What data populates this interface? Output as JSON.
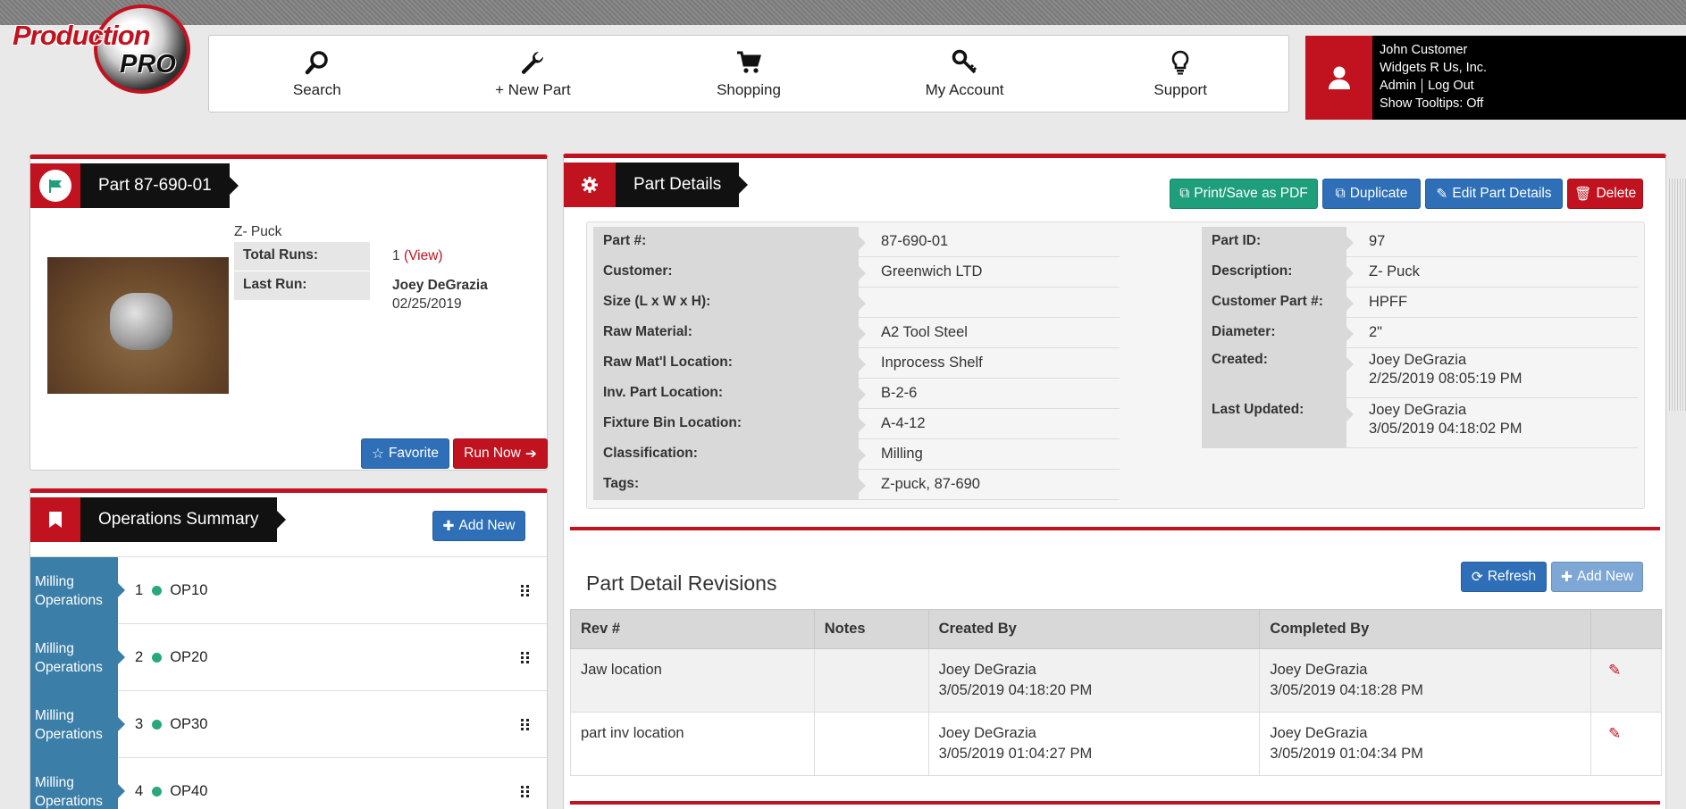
{
  "app": {
    "logo_text_1": "Production",
    "logo_text_2": "PRO"
  },
  "nav": [
    {
      "label": "Search",
      "icon": "search-icon"
    },
    {
      "label": "+ New Part",
      "icon": "wrench-icon"
    },
    {
      "label": "Shopping",
      "icon": "cart-icon"
    },
    {
      "label": "My Account",
      "icon": "key-icon"
    },
    {
      "label": "Support",
      "icon": "lightbulb-icon"
    }
  ],
  "user": {
    "name": "John Customer",
    "company": "Widgets R Us, Inc.",
    "admin_link": "Admin",
    "logout_link": "Log Out",
    "tooltips": "Show Tooltips: Off"
  },
  "part_card": {
    "title": "Part 87-690-01",
    "description": "Z- Puck",
    "total_runs_label": "Total Runs:",
    "total_runs_value": "1",
    "view_link": "(View)",
    "last_run_label": "Last Run:",
    "last_run_name": "Joey DeGrazia",
    "last_run_date": "02/25/2019",
    "favorite_button": "Favorite",
    "run_now_button": "Run Now"
  },
  "operations": {
    "title": "Operations Summary",
    "add_new_button": "Add New",
    "rows": [
      {
        "type": "Milling Operations",
        "num": "1",
        "op": "OP10"
      },
      {
        "type": "Milling Operations",
        "num": "2",
        "op": "OP20"
      },
      {
        "type": "Milling Operations",
        "num": "3",
        "op": "OP30"
      },
      {
        "type": "Milling Operations",
        "num": "4",
        "op": "OP40"
      }
    ]
  },
  "part_details": {
    "title": "Part Details",
    "buttons": {
      "print": "Print/Save as PDF",
      "duplicate": "Duplicate",
      "edit": "Edit Part Details",
      "delete": "Delete"
    },
    "left": [
      {
        "label": "Part #:",
        "value": "87-690-01"
      },
      {
        "label": "Customer:",
        "value": "Greenwich LTD"
      },
      {
        "label": "Size (L x W x H):",
        "value": ""
      },
      {
        "label": "Raw Material:",
        "value": "A2 Tool Steel"
      },
      {
        "label": "Raw Mat'l Location:",
        "value": "Inprocess Shelf"
      },
      {
        "label": "Inv. Part Location:",
        "value": "B-2-6"
      },
      {
        "label": "Fixture Bin Location:",
        "value": "A-4-12"
      },
      {
        "label": "Classification:",
        "value": "Milling"
      },
      {
        "label": "Tags:",
        "value": "Z-puck, 87-690"
      }
    ],
    "right": [
      {
        "label": "Part ID:",
        "value": "97"
      },
      {
        "label": "Description:",
        "value": "Z- Puck"
      },
      {
        "label": "Customer Part #:",
        "value": "HPFF"
      },
      {
        "label": "Diameter:",
        "value": "2\""
      },
      {
        "label": "Created:",
        "value": "Joey DeGrazia",
        "value2": "2/25/2019 08:05:19 PM"
      },
      {
        "label": "Last Updated:",
        "value": "Joey DeGrazia",
        "value2": "3/05/2019 04:18:02 PM"
      }
    ]
  },
  "revisions": {
    "title": "Part Detail Revisions",
    "refresh_button": "Refresh",
    "add_new_button": "Add New",
    "headers": [
      "Rev #",
      "Notes",
      "Created By",
      "Completed By"
    ],
    "rows": [
      {
        "rev": "Jaw location",
        "notes": "",
        "created_name": "Joey DeGrazia",
        "created_date": "3/05/2019 04:18:20 PM",
        "completed_name": "Joey DeGrazia",
        "completed_date": "3/05/2019 04:18:28 PM"
      },
      {
        "rev": "part inv location",
        "notes": "",
        "created_name": "Joey DeGrazia",
        "created_date": "3/05/2019 01:04:27 PM",
        "completed_name": "Joey DeGrazia",
        "completed_date": "3/05/2019 01:04:34 PM"
      }
    ]
  },
  "colors": {
    "brand_red": "#c1121f",
    "ops_blue": "#3b7ea7",
    "button_blue": "#2e6fb7",
    "button_green": "#1f9e7c"
  }
}
